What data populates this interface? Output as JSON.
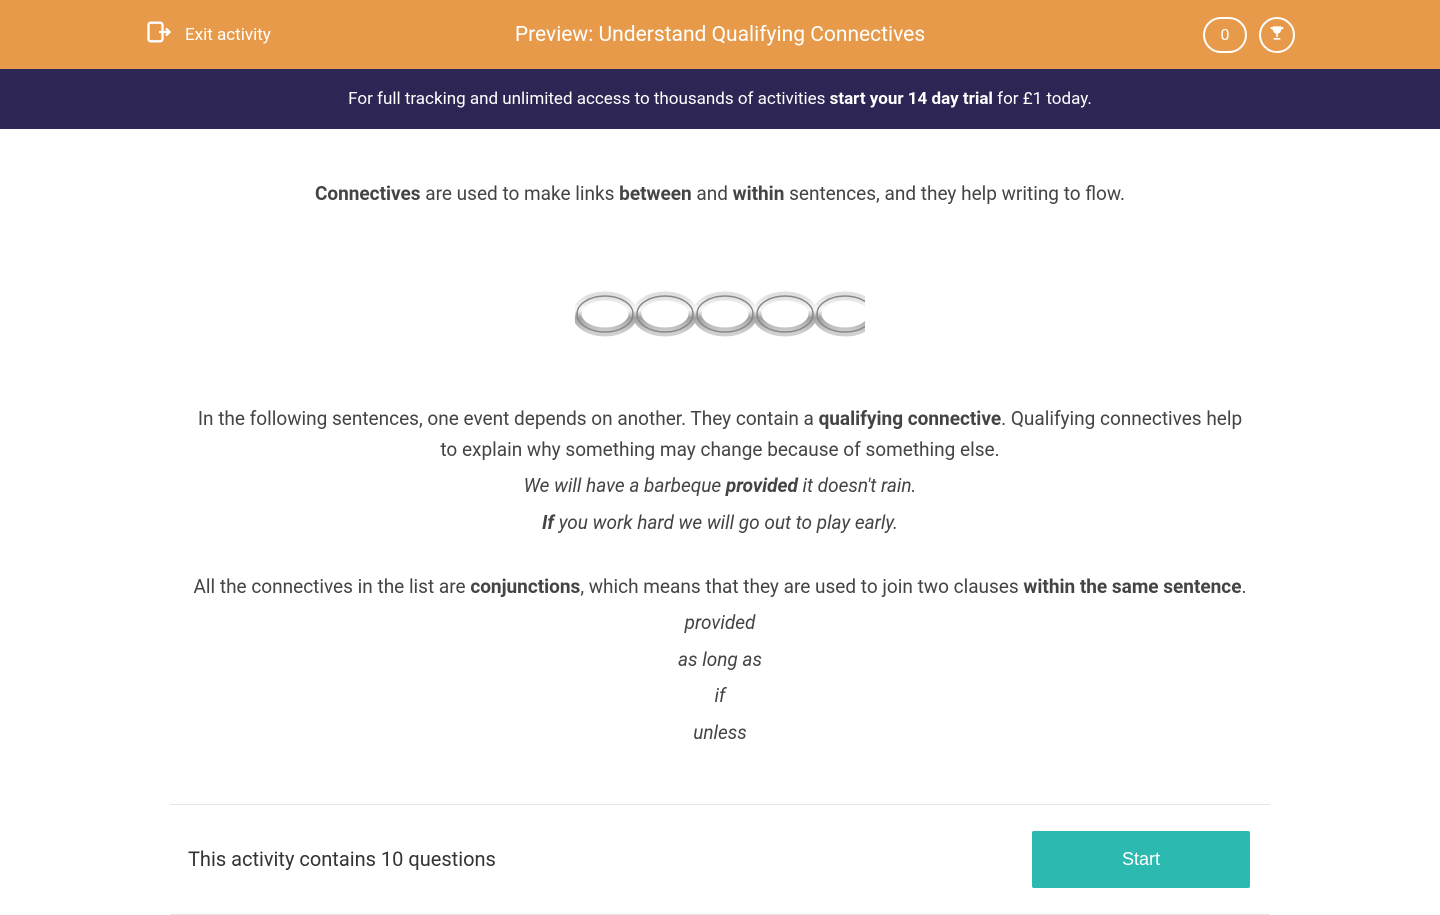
{
  "header": {
    "exit_label": "Exit activity",
    "title": "Preview: Understand Qualifying Connectives",
    "score": "0"
  },
  "banner": {
    "prefix": "For full tracking and unlimited access to thousands of activities ",
    "bold": "start your 14 day trial",
    "suffix": " for £1 today."
  },
  "content": {
    "intro": {
      "w1": "Connectives",
      "t1": " are used to make links ",
      "w2": "between",
      "t2": " and ",
      "w3": "within",
      "t3": " sentences, and they help writing to flow."
    },
    "para2": {
      "t1": "In the following sentences, one event depends on another. They contain a ",
      "w1": "qualifying connective",
      "t2": ". Qualifying connectives help to explain why something may change because of something else."
    },
    "example1": {
      "pre": "We will have a barbeque ",
      "bold": "provided",
      "post": " it doesn't rain."
    },
    "example2": {
      "bold": "If",
      "post": " you work hard we will go out to play early."
    },
    "para3": {
      "t1": "All the connectives in the list are ",
      "w1": "conjunctions",
      "t2": ", which means that they are used to join two clauses ",
      "w2": "within the same sentence",
      "t3": "."
    },
    "list": {
      "i1": "provided",
      "i2": "as long as",
      "i3": "if",
      "i4": "unless"
    }
  },
  "footer": {
    "text": "This activity contains 10 questions",
    "button": "Start"
  }
}
